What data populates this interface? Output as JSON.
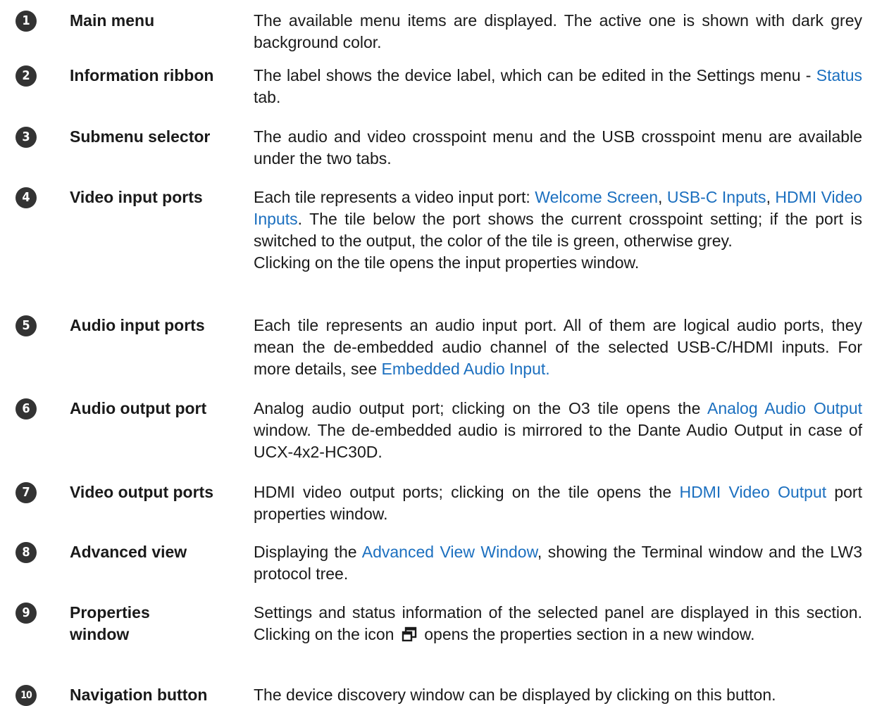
{
  "items": [
    {
      "number": "1",
      "term": "Main menu",
      "desc": [
        {
          "t": "The available menu items are displayed. The active one is shown with dark grey background color."
        }
      ]
    },
    {
      "number": "2",
      "term": "Information ribbon",
      "desc": [
        {
          "t": "The label shows the device label, which can be edited in the Settings menu - "
        },
        {
          "t": "Status",
          "link": true
        },
        {
          "t": " tab."
        }
      ]
    },
    {
      "number": "3",
      "term": "Submenu selector",
      "desc": [
        {
          "t": "The audio and video crosspoint menu and the USB crosspoint menu are available under the two tabs."
        }
      ]
    },
    {
      "number": "4",
      "term": "Video input ports",
      "desc": [
        {
          "t": "Each tile represents a video input port: "
        },
        {
          "t": "Welcome Screen",
          "link": true
        },
        {
          "t": ", "
        },
        {
          "t": "USB-C Inputs",
          "link": true
        },
        {
          "t": ", "
        },
        {
          "t": "HDMI Video Inputs",
          "link": true
        },
        {
          "t": ". The tile below the port shows the current crosspoint setting; if the port is switched to the output, the color of the tile is green, otherwise grey."
        },
        {
          "br": true
        },
        {
          "t": "Clicking on the tile opens the input properties window."
        }
      ]
    },
    {
      "number": "5",
      "term": "Audio input ports",
      "desc": [
        {
          "t": "Each tile represents an audio input port. All of them are logical audio ports, they mean the de-embedded audio channel of the selected USB-C/HDMI inputs. For more details, see "
        },
        {
          "t": "Embedded Audio Input.",
          "link": true
        }
      ]
    },
    {
      "number": "6",
      "term": "Audio output port",
      "desc": [
        {
          "t": "Analog audio output port; clicking on the O3 tile opens the "
        },
        {
          "t": "Analog Audio Output",
          "link": true
        },
        {
          "t": " window. The de-embedded audio is mirrored to the Dante Audio Output in case of UCX-4x2-HC30D."
        }
      ]
    },
    {
      "number": "7",
      "term": "Video output ports",
      "desc": [
        {
          "t": "HDMI video output ports; clicking on the tile opens the "
        },
        {
          "t": "HDMI Video Output",
          "link": true
        },
        {
          "t": " port properties window."
        }
      ]
    },
    {
      "number": "8",
      "term": "Advanced view",
      "desc": [
        {
          "t": "Displaying the "
        },
        {
          "t": "Advanced View Window",
          "link": true
        },
        {
          "t": ", showing the Terminal window and the LW3 protocol tree."
        }
      ]
    },
    {
      "number": "9",
      "term": "Properties window",
      "desc": [
        {
          "t": "Settings and status information of the selected panel are displayed in this section. Clicking on the icon "
        },
        {
          "icon": "open-in-new-window-icon"
        },
        {
          "t": " opens the properties section in a new window."
        }
      ]
    },
    {
      "number": "10",
      "term": "Navigation button",
      "desc": [
        {
          "t": "The device discovery window can be displayed by clicking on this button."
        }
      ]
    }
  ],
  "colors": {
    "link": "#1b6fbf",
    "badge": "#333333",
    "text": "#1a1a1a"
  }
}
